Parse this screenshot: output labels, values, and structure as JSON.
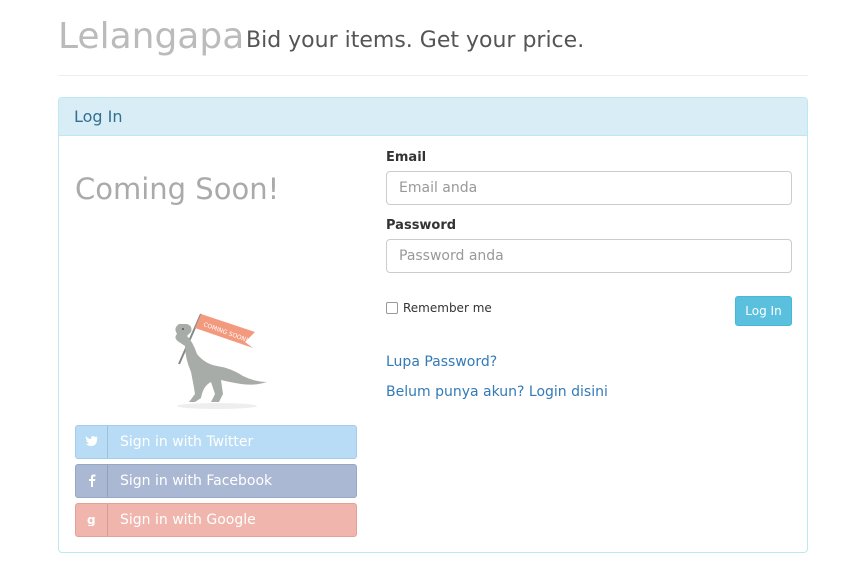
{
  "header": {
    "brand": "Lelangapa",
    "tagline": "Bid your items. Get your price."
  },
  "panel": {
    "title": "Log In"
  },
  "left": {
    "coming_soon": "Coming Soon!",
    "flag_text": "COMING SOON!",
    "social": {
      "twitter": "Sign in with Twitter",
      "facebook": "Sign in with Facebook",
      "google": "Sign in with Google"
    }
  },
  "form": {
    "email_label": "Email",
    "email_placeholder": "Email anda",
    "password_label": "Password",
    "password_placeholder": "Password anda",
    "remember_label": "Remember me",
    "login_button": "Log In",
    "forgot_link": "Lupa Password?",
    "register_link": "Belum punya akun? Login disini"
  },
  "colors": {
    "panel_heading_bg": "#d9edf7",
    "panel_border": "#bce8f1",
    "login_button": "#5bc0de",
    "link": "#337ab7",
    "twitter": "#b8dcf5",
    "facebook": "#aab8d3",
    "google": "#f0b6ad"
  }
}
